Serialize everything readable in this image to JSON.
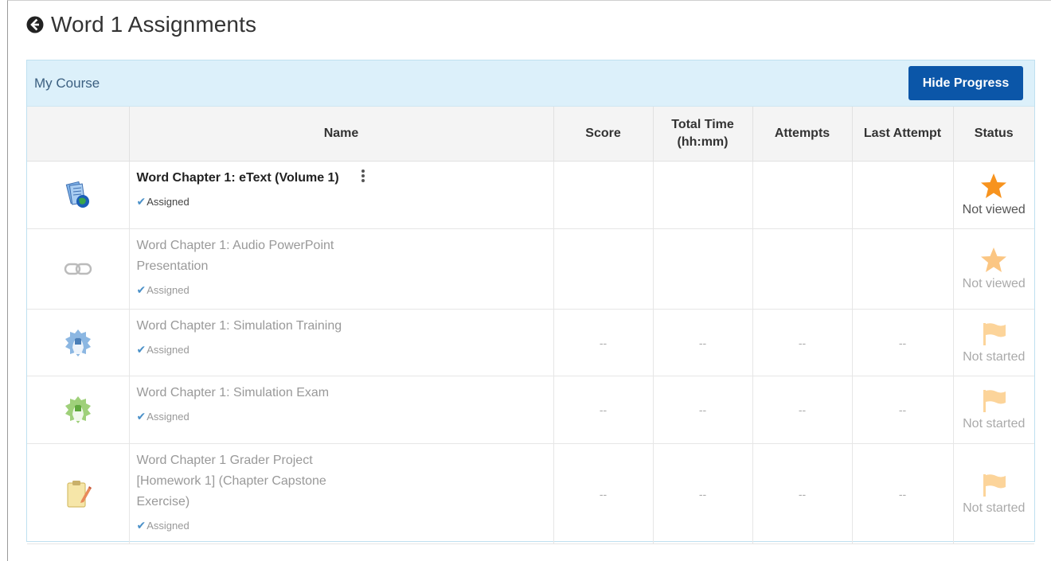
{
  "page": {
    "title": "Word 1 Assignments"
  },
  "panel": {
    "course_name": "My Course",
    "hide_progress_label": "Hide Progress"
  },
  "columns": [
    "Name",
    "Score",
    "Total Time\n(hh:mm)",
    "Attempts",
    "Last Attempt",
    "Status"
  ],
  "rows": [
    {
      "title": "Word Chapter 1: eText (Volume 1)",
      "assigned": "Assigned",
      "icon": "etext-book-globe-icon",
      "score": "",
      "total_time": "",
      "attempts": "",
      "last_attempt": "",
      "status": "Not viewed",
      "status_icon": "star-icon"
    },
    {
      "title": "Word Chapter 1: Audio PowerPoint Presentation",
      "assigned": "Assigned",
      "icon": "link-chain-icon",
      "score": "",
      "total_time": "",
      "attempts": "",
      "last_attempt": "",
      "status": "Not viewed",
      "status_icon": "star-icon"
    },
    {
      "title": "Word Chapter 1: Simulation Training",
      "assigned": "Assigned",
      "icon": "simulation-training-icon",
      "score": "--",
      "total_time": "--",
      "attempts": "--",
      "last_attempt": "--",
      "status": "Not started",
      "status_icon": "flag-icon"
    },
    {
      "title": "Word Chapter 1: Simulation Exam",
      "assigned": "Assigned",
      "icon": "simulation-exam-icon",
      "score": "--",
      "total_time": "--",
      "attempts": "--",
      "last_attempt": "--",
      "status": "Not started",
      "status_icon": "flag-icon"
    },
    {
      "title": "Word Chapter 1 Grader Project [Homework 1] (Chapter Capstone Exercise)",
      "assigned": "Assigned",
      "icon": "grader-project-clipboard-icon",
      "score": "--",
      "total_time": "--",
      "attempts": "--",
      "last_attempt": "--",
      "status": "Not started",
      "status_icon": "flag-icon"
    }
  ],
  "colors": {
    "accent_button": "#0b56a8",
    "panel_header_bg": "#dcf0fa",
    "star_active": "#f7931e",
    "star_faded": "#fbc683",
    "flag_faded": "#fcd49a",
    "check": "#4a90c8"
  }
}
